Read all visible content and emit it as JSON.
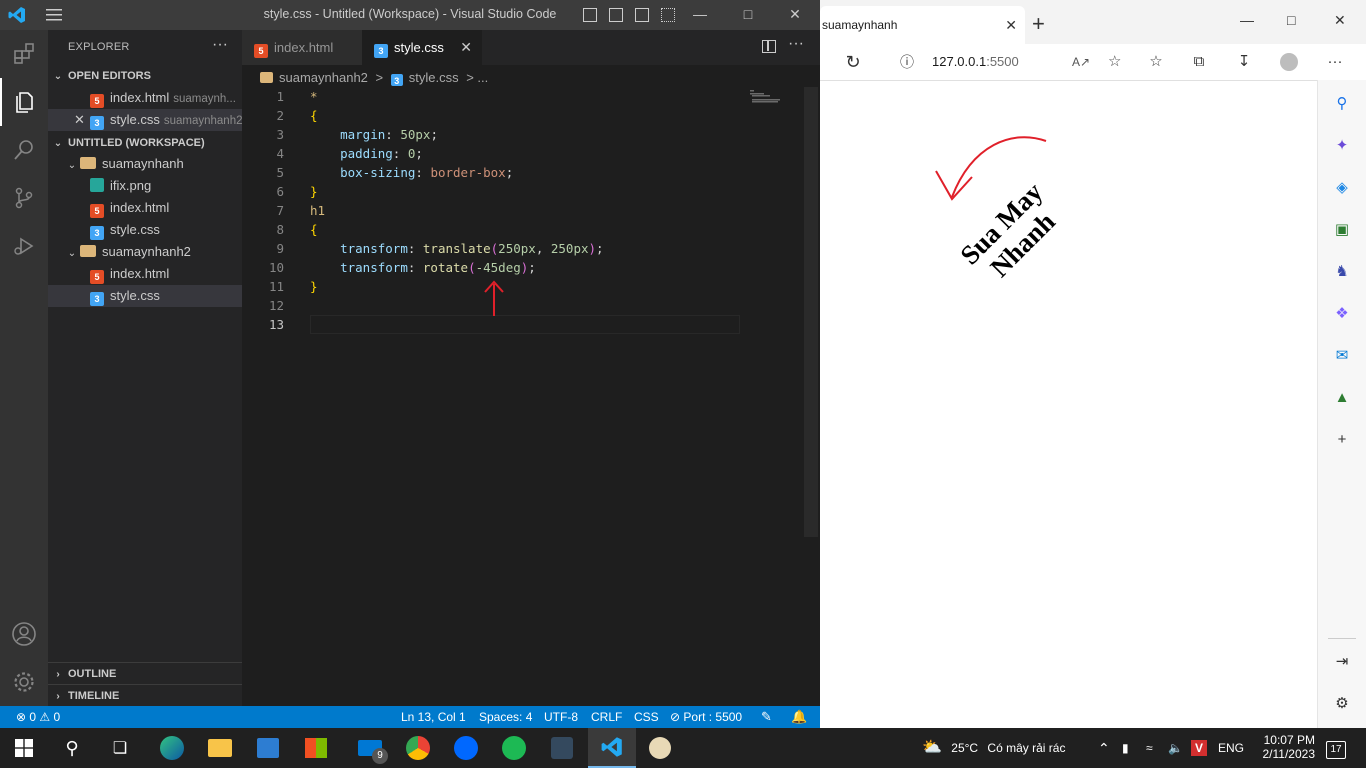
{
  "vscode": {
    "window_title": "style.css - Untitled (Workspace) - Visual Studio Code",
    "explorer_title": "EXPLORER",
    "explorer_more": "···",
    "open_editors_label": "OPEN EDITORS",
    "open_editors": [
      {
        "name": "index.html",
        "desc": "suamaynh...",
        "type": "html"
      },
      {
        "name": "style.css",
        "desc": "suamaynhanh2",
        "type": "css",
        "selected": true
      }
    ],
    "workspace_label": "UNTITLED (WORKSPACE)",
    "folders": [
      {
        "name": "suamaynhanh",
        "files": [
          {
            "name": "ifix.png",
            "type": "png"
          },
          {
            "name": "index.html",
            "type": "html"
          },
          {
            "name": "style.css",
            "type": "css"
          }
        ]
      },
      {
        "name": "suamaynhanh2",
        "files": [
          {
            "name": "index.html",
            "type": "html"
          },
          {
            "name": "style.css",
            "type": "css",
            "selected": true
          }
        ]
      }
    ],
    "outline_label": "OUTLINE",
    "timeline_label": "TIMELINE",
    "tabs": [
      {
        "label": "index.html",
        "active": false
      },
      {
        "label": "style.css",
        "active": true
      }
    ],
    "breadcrumb": {
      "folder": "suamaynhanh2",
      "sep": ">",
      "file": "style.css",
      "rest": "> ..."
    },
    "line_numbers": [
      "1",
      "2",
      "3",
      "4",
      "5",
      "6",
      "7",
      "8",
      "9",
      "10",
      "11",
      "12",
      "13"
    ],
    "code": {
      "l1": "*",
      "l2": "{",
      "l3_prop": "margin",
      "l3_val": "50px",
      "l4_prop": "padding",
      "l4_val": "0",
      "l5_prop": "box-sizing",
      "l5_val": "border-box",
      "l6": "}",
      "l7": "h1",
      "l8": "{",
      "l9_prop": "transform",
      "l9_fn": "translate",
      "l9_a": "250px",
      "l9_b": "250px",
      "l10_prop": "transform",
      "l10_fn": "rotate",
      "l10_a": "-45deg",
      "l11": "}"
    },
    "status": {
      "problems": "⊗ 0 ⚠ 0",
      "position": "Ln 13, Col 1",
      "spaces": "Spaces: 4",
      "encoding": "UTF-8",
      "eol": "CRLF",
      "language": "CSS",
      "port": "⊘ Port : 5500"
    }
  },
  "edge": {
    "tab_title": "suamaynhanh",
    "url_host": "127.0.0.1",
    "url_port": ":5500",
    "page_heading": "Sua May Nhanh"
  },
  "taskbar": {
    "weather_temp": "25°C",
    "weather_text": "Có mây rải rác",
    "language": "ENG",
    "time": "10:07 PM",
    "date": "2/11/2023",
    "mail_badge": "9",
    "notif_count": "17"
  },
  "colors": {
    "vscode_blue": "#007acc",
    "annotation_red": "#e0202a"
  }
}
